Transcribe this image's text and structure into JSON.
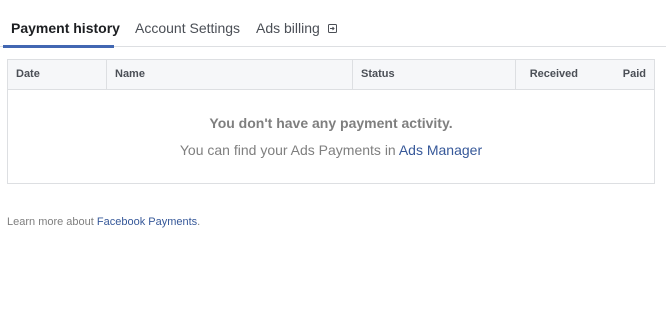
{
  "tabs": {
    "payment_history": "Payment history",
    "account_settings": "Account Settings",
    "ads_billing": "Ads billing"
  },
  "table": {
    "columns": [
      "Date",
      "Name",
      "Status",
      "Received",
      "Paid"
    ],
    "empty_title": "You don't have any payment activity.",
    "empty_sub_prefix": "You can find your Ads Payments in ",
    "empty_sub_link": "Ads Manager"
  },
  "footer": {
    "prefix": "Learn more about ",
    "link": "Facebook Payments",
    "suffix": "."
  },
  "colors": {
    "accent": "#4267b2",
    "link": "#365899",
    "muted_text": "#7f7f7f"
  },
  "icons": {
    "ads_billing_tab": "external-link-icon"
  }
}
